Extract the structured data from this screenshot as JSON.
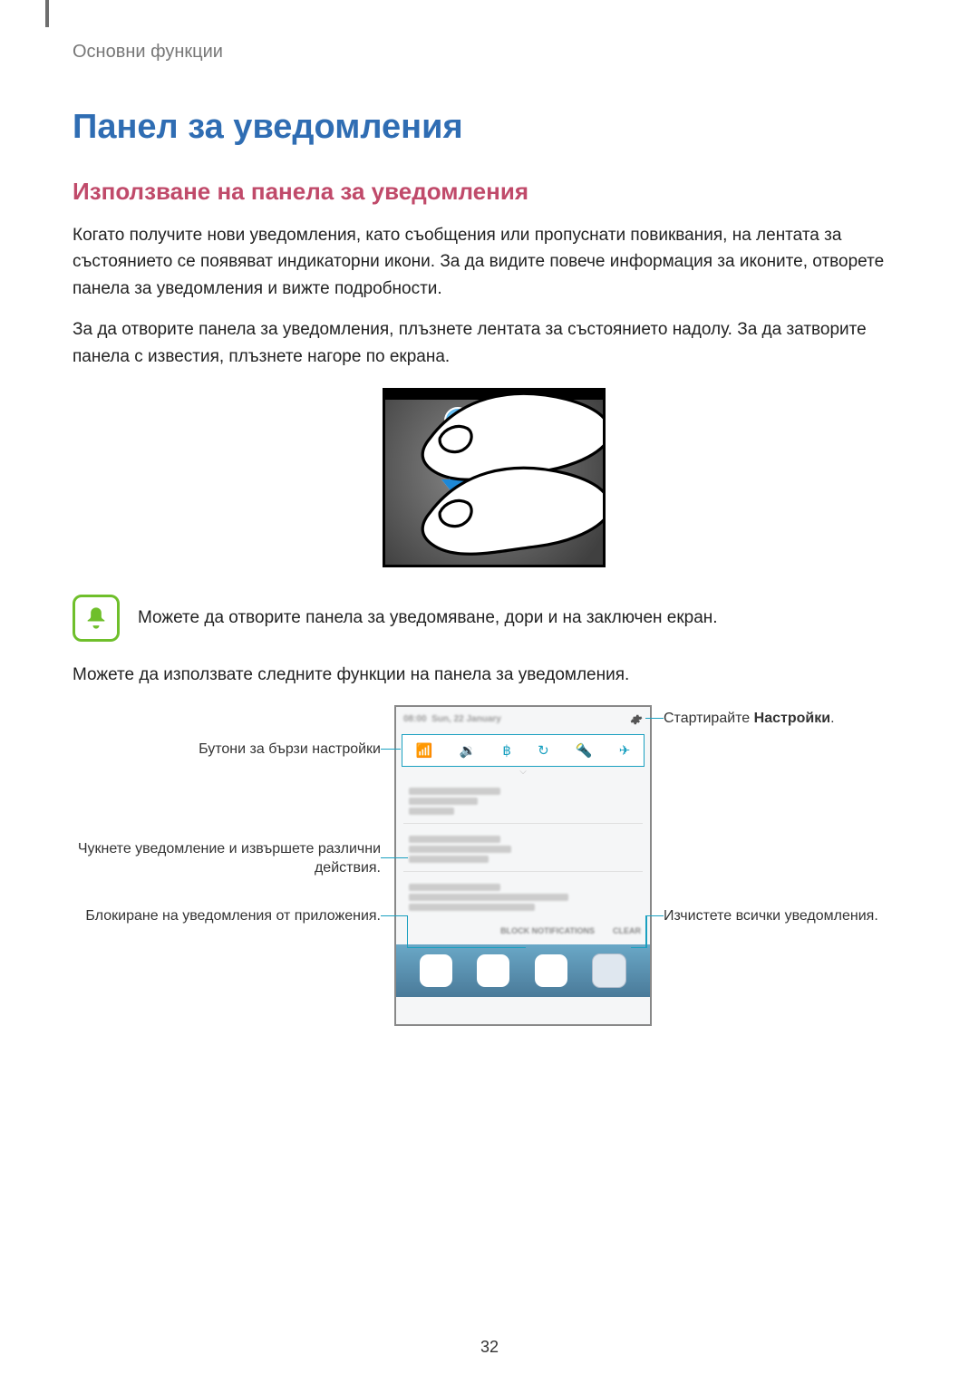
{
  "breadcrumb": "Основни функции",
  "title": "Панел за уведомления",
  "subtitle": "Използване на панела за уведомления",
  "para1": "Когато получите нови уведомления, като съобщения или пропуснати повиквания, на лентата за състоянието се появяват индикаторни икони. За да видите повече информация за иконите, отворете панела за уведомления и вижте подробности.",
  "para2": "За да отворите панела за уведомления, плъзнете лентата за състоянието надолу. За да затворите панела с известия, плъзнете нагоре по екрана.",
  "note": "Можете да отворите панела за уведомяване, дори и на заключен екран.",
  "para3": "Можете да използвате следните функции на панела за уведомления.",
  "callouts": {
    "quick_settings": "Бутони за бързи настройки",
    "tap_notification": "Чукнете уведомление и извършете различни действия.",
    "block_notifications": "Блокиране на уведомления от приложения.",
    "launch_settings_a": "Стартирайте ",
    "launch_settings_b": "Настройки",
    "launch_settings_c": ".",
    "clear_all": "Изчистете всички уведомления."
  },
  "page_number": "32"
}
